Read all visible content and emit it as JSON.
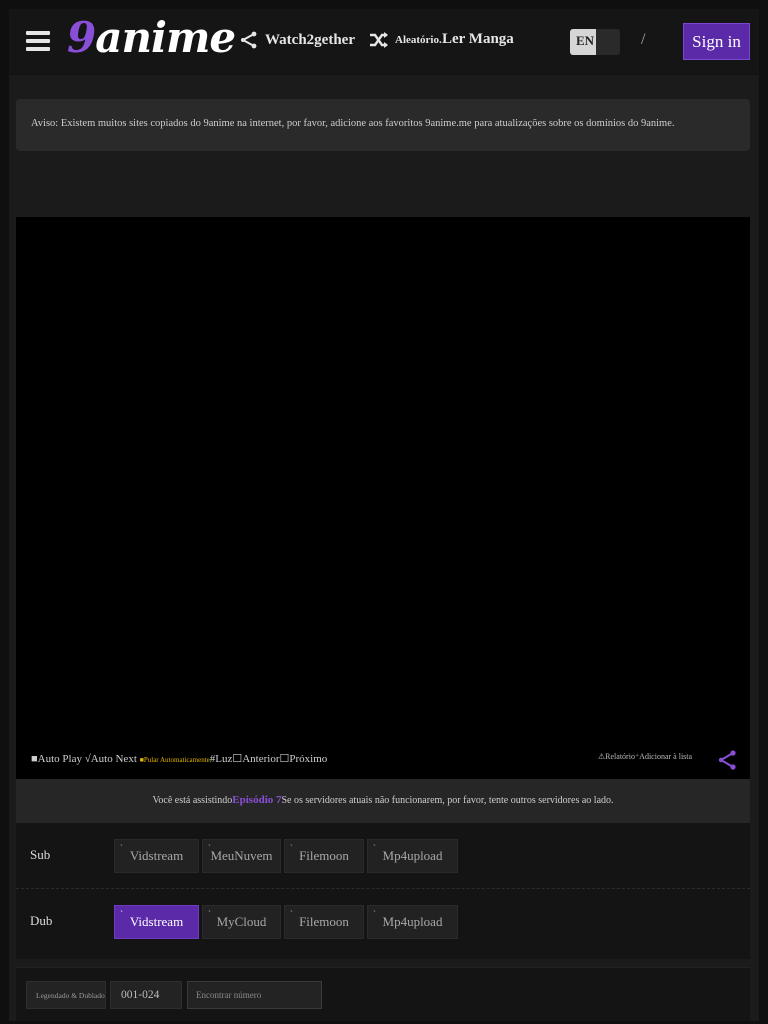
{
  "header": {
    "logo_nine": "9",
    "logo_rest": "anime",
    "watch2gether": "Watch2gether",
    "random_label": "Aleatório.",
    "read_manga": "Ler Manga",
    "language": "EN",
    "separator": "/",
    "sign_in": "Sign in"
  },
  "notice": {
    "text": "Aviso: Existem muitos sites copiados do 9anime na internet, por favor, adicione aos favoritos 9anime.me para atualizações sobre os domínios do 9anime."
  },
  "controls": {
    "auto_play": "■Auto Play",
    "auto_next": " √Auto Next ",
    "auto_skip": "■Pular Automaticamente",
    "light": "#Luz",
    "previous": "☐Anterior",
    "next": "☐Próximo",
    "report": "⚠Relatório",
    "add_to_list": "⁺Adicionar à lista"
  },
  "watching": {
    "prefix": "Você está assistindo",
    "episode": "Episódio 7",
    "suffix": "Se os servidores atuais não funcionarem, por favor, tente outros servidores ao lado."
  },
  "servers": {
    "sub_label": "Sub",
    "dub_label": "Dub",
    "sub": [
      "Vidstream",
      "MeuNuvem",
      "Filemoon",
      "Mp4upload"
    ],
    "dub": [
      "Vidstream",
      "MyCloud",
      "Filemoon",
      "Mp4upload"
    ],
    "active_dub": "Vidstream"
  },
  "episodes": {
    "type_label": "Legendado & Dublado",
    "range": "001-024",
    "search_placeholder": "Encontrar número"
  },
  "colors": {
    "accent": "#5b2aa8",
    "accent_text": "#8a4fd8",
    "auto_skip": "#e5b400"
  }
}
